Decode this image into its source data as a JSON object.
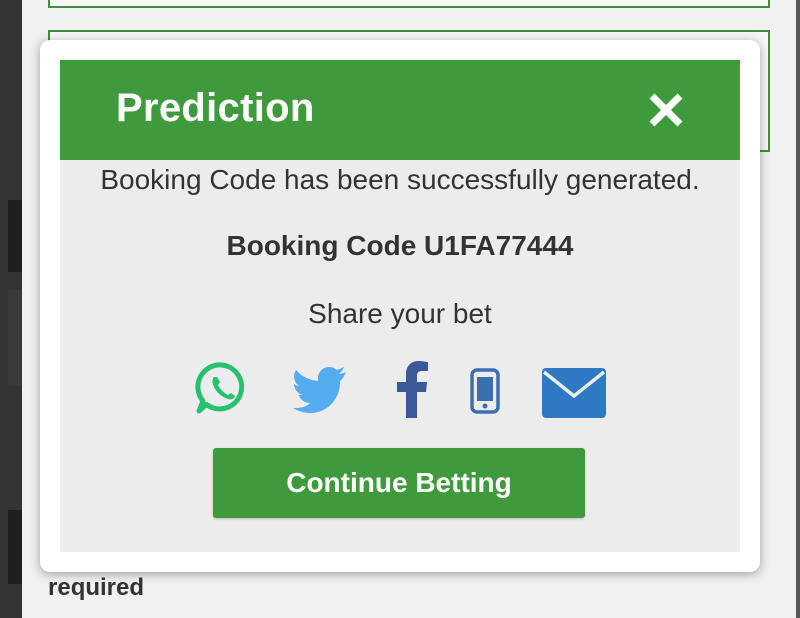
{
  "background": {
    "required_label": "required"
  },
  "modal": {
    "title": "Prediction",
    "message": "Booking Code has been successfully generated.",
    "booking_code_line": "Booking Code U1FA77444",
    "share_label": "Share your bet",
    "continue_label": "Continue Betting",
    "share_icons": [
      "whatsapp-icon",
      "twitter-icon",
      "facebook-icon",
      "sms-phone-icon",
      "email-icon"
    ]
  },
  "colors": {
    "header_green": "#3f9a3c",
    "whatsapp": "#25c16f",
    "twitter": "#55acee",
    "facebook": "#3b5998",
    "phone": "#3a6fb0",
    "email": "#2f79c2"
  }
}
